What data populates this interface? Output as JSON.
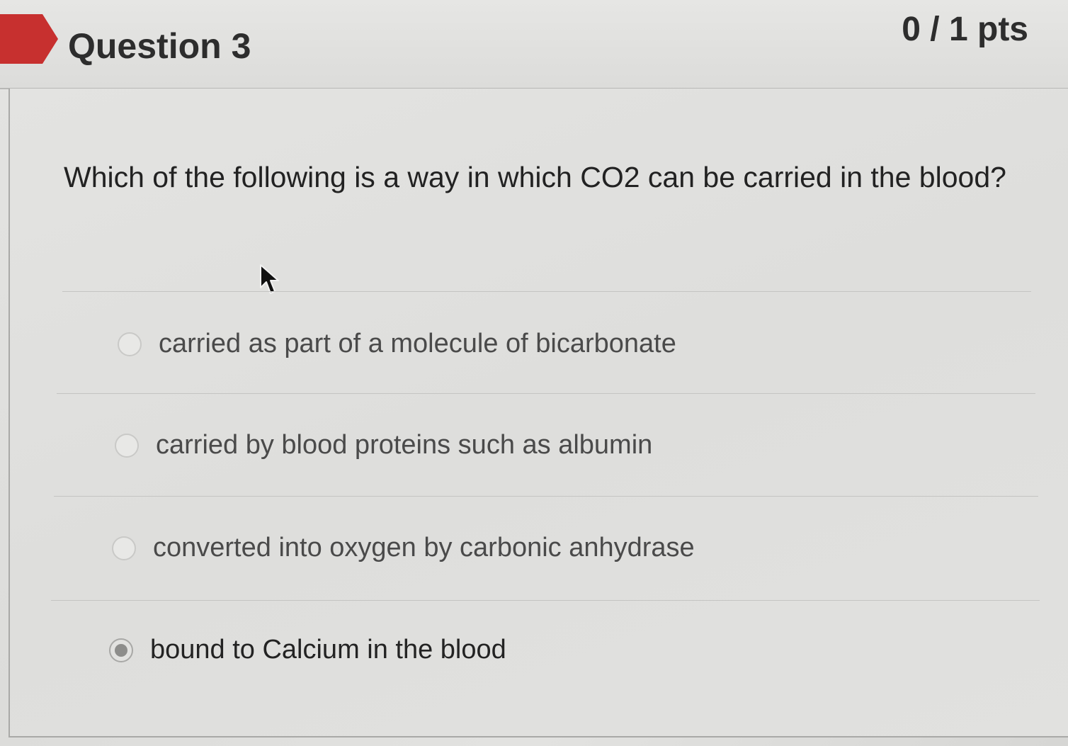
{
  "question": {
    "title": "Question 3",
    "points": "0 / 1 pts",
    "text": "Which of the following is a way in which CO2 can be carried in the blood?",
    "answers": [
      {
        "label": "carried as part of a molecule of bicarbonate",
        "selected": false
      },
      {
        "label": "carried by blood proteins such as albumin",
        "selected": false
      },
      {
        "label": "converted into oxygen by carbonic anhydrase",
        "selected": false
      },
      {
        "label": "bound to Calcium in the blood",
        "selected": true
      }
    ]
  },
  "colors": {
    "flag": "#c7302f",
    "text": "#2d2d2d",
    "divider": "#c4c4c2"
  },
  "icons": {
    "flag": "question-flag-icon",
    "cursor": "mouse-pointer-icon",
    "radio": "radio-button-icon"
  }
}
